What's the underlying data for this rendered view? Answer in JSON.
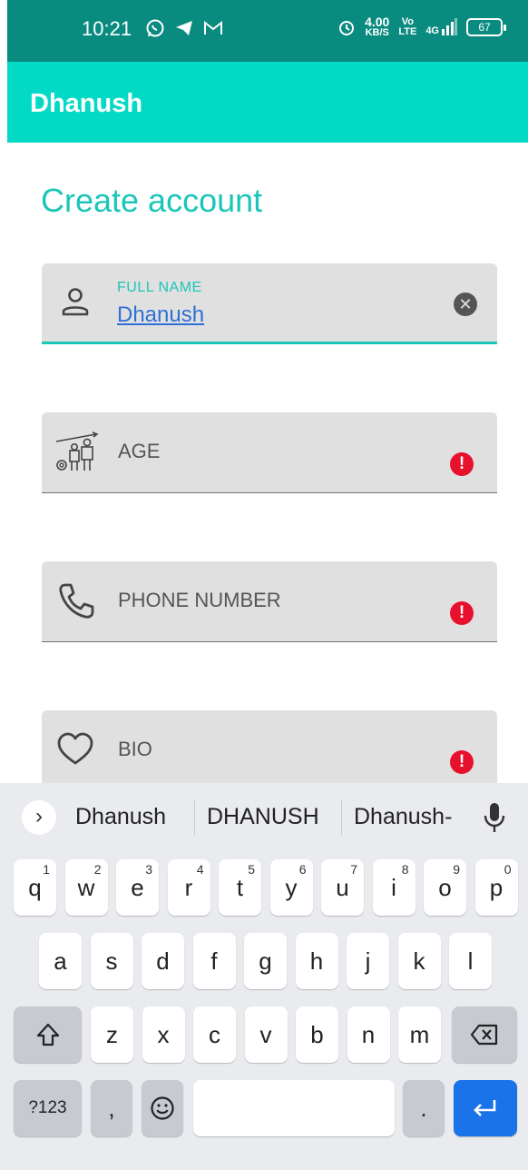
{
  "status_bar": {
    "time": "10:21",
    "speed_value": "4.00",
    "speed_unit": "KB/S",
    "volte_top": "Vo",
    "volte_bottom": "LTE",
    "network": "4G",
    "battery": "67",
    "icons_left": [
      "whatsapp-icon",
      "telegram-icon",
      "gmail-icon"
    ],
    "icons_right": [
      "alarm-icon",
      "signal-icon",
      "battery-icon"
    ]
  },
  "app_bar": {
    "title": "Dhanush",
    "color": "#03dac5"
  },
  "page": {
    "title": "Create account",
    "accent": "#1bc6b8"
  },
  "form": {
    "full_name": {
      "label": "FULL NAME",
      "value": "Dhanush"
    },
    "age": {
      "placeholder": "AGE"
    },
    "phone": {
      "placeholder": "PHONE NUMBER"
    },
    "bio": {
      "placeholder": "BIO"
    }
  },
  "keyboard": {
    "suggestions": [
      "Dhanush",
      "DHANUSH",
      "Dhanush-"
    ],
    "row1": [
      {
        "k": "q",
        "n": "1"
      },
      {
        "k": "w",
        "n": "2"
      },
      {
        "k": "e",
        "n": "3"
      },
      {
        "k": "r",
        "n": "4"
      },
      {
        "k": "t",
        "n": "5"
      },
      {
        "k": "y",
        "n": "6"
      },
      {
        "k": "u",
        "n": "7"
      },
      {
        "k": "i",
        "n": "8"
      },
      {
        "k": "o",
        "n": "9"
      },
      {
        "k": "p",
        "n": "0"
      }
    ],
    "row2": [
      "a",
      "s",
      "d",
      "f",
      "g",
      "h",
      "j",
      "k",
      "l"
    ],
    "row3": [
      "z",
      "x",
      "c",
      "v",
      "b",
      "n",
      "m"
    ],
    "symbols_label": "?123",
    "comma_label": ",",
    "period_label": ".",
    "enter_color": "#1a73e8"
  }
}
